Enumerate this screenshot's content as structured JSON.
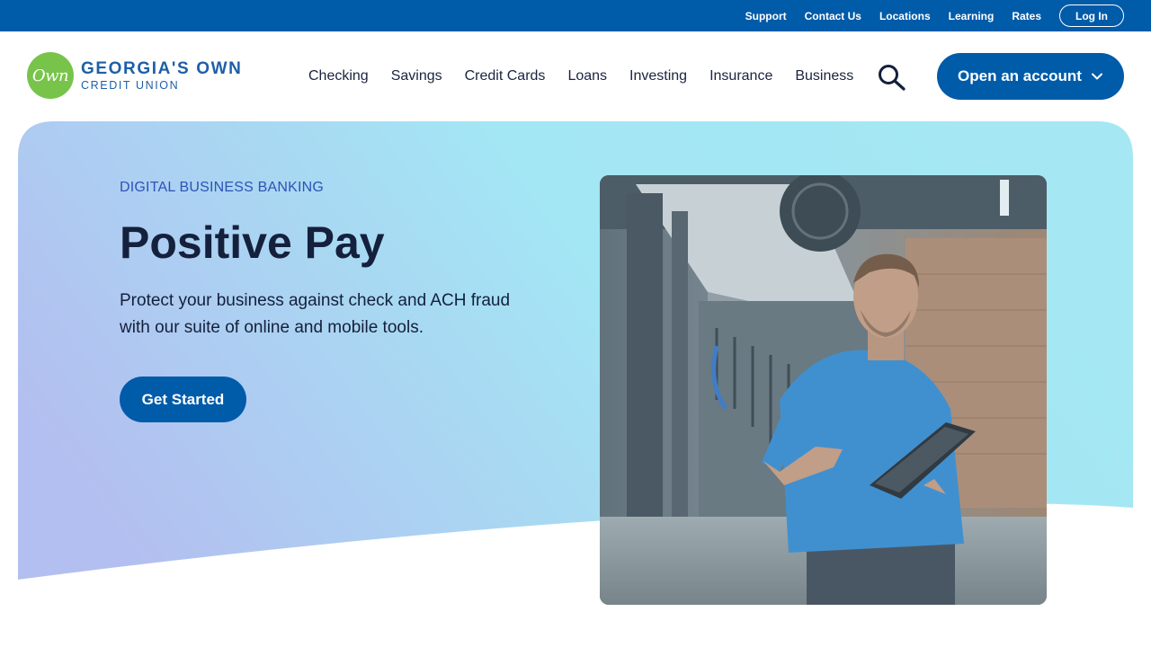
{
  "utility": {
    "links": [
      "Support",
      "Contact Us",
      "Locations",
      "Learning",
      "Rates"
    ],
    "login_label": "Log In"
  },
  "brand": {
    "logo_mark": "Own",
    "name": "GEORGIA'S OWN",
    "subname": "CREDIT UNION"
  },
  "nav": {
    "items": [
      "Checking",
      "Savings",
      "Credit Cards",
      "Loans",
      "Investing",
      "Insurance",
      "Business"
    ],
    "search_icon": "search-icon",
    "open_account_label": "Open an account"
  },
  "hero": {
    "eyebrow": "DIGITAL BUSINESS BANKING",
    "title": "Positive Pay",
    "description": "Protect your business against check and ACH fraud with our suite of online and mobile tools.",
    "cta_label": "Get Started"
  },
  "colors": {
    "primary": "#005ba9",
    "logo_green": "#78c44b",
    "eyebrow_blue": "#2d53b6",
    "text_dark": "#14203c",
    "hero_gradient_start": "#b3bff0",
    "hero_gradient_end": "#a3e6f4"
  }
}
